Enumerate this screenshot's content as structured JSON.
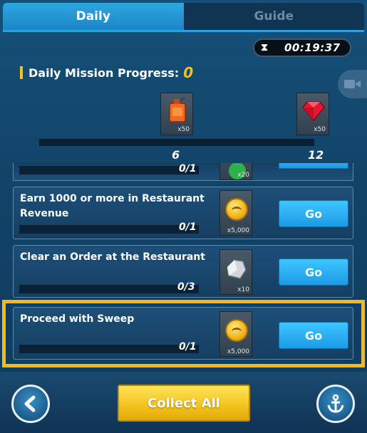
{
  "tabs": [
    {
      "label": "Daily",
      "active": true
    },
    {
      "label": "Guide",
      "active": false
    }
  ],
  "timer": {
    "icon": "hourglass-icon",
    "value": "00:19:37"
  },
  "progress": {
    "title": "Daily Mission Progress:",
    "value": "0",
    "fraction": 0,
    "milestones": [
      {
        "value": "6",
        "reward_icon": "fuel-can-icon",
        "reward_qty": "x50"
      },
      {
        "value": "12",
        "reward_icon": "ruby-icon",
        "reward_qty": "x50"
      }
    ]
  },
  "partial_mission": {
    "count": "0/1",
    "reward_qty": "x20"
  },
  "missions": [
    {
      "title": "Earn 1000 or more in Restaurant Revenue",
      "count": "0/1",
      "reward_icon": "gold-coin-icon",
      "reward_qty": "x5,000",
      "button": "Go"
    },
    {
      "title": "Clear an Order at the Restaurant",
      "count": "0/3",
      "reward_icon": "stone-icon",
      "reward_qty": "x10",
      "button": "Go"
    },
    {
      "title": "Proceed with Sweep",
      "count": "0/1",
      "reward_icon": "gold-coin-icon",
      "reward_qty": "x5,000",
      "button": "Go"
    }
  ],
  "footer": {
    "collect_label": "Collect All",
    "back_icon": "chevron-left-icon",
    "anchor_icon": "anchor-icon"
  },
  "colors": {
    "accent_yellow": "#f7c01c",
    "tab_blue": "#2aa4e0",
    "go_blue": "#1d9be7",
    "highlight": "#f9b914"
  }
}
